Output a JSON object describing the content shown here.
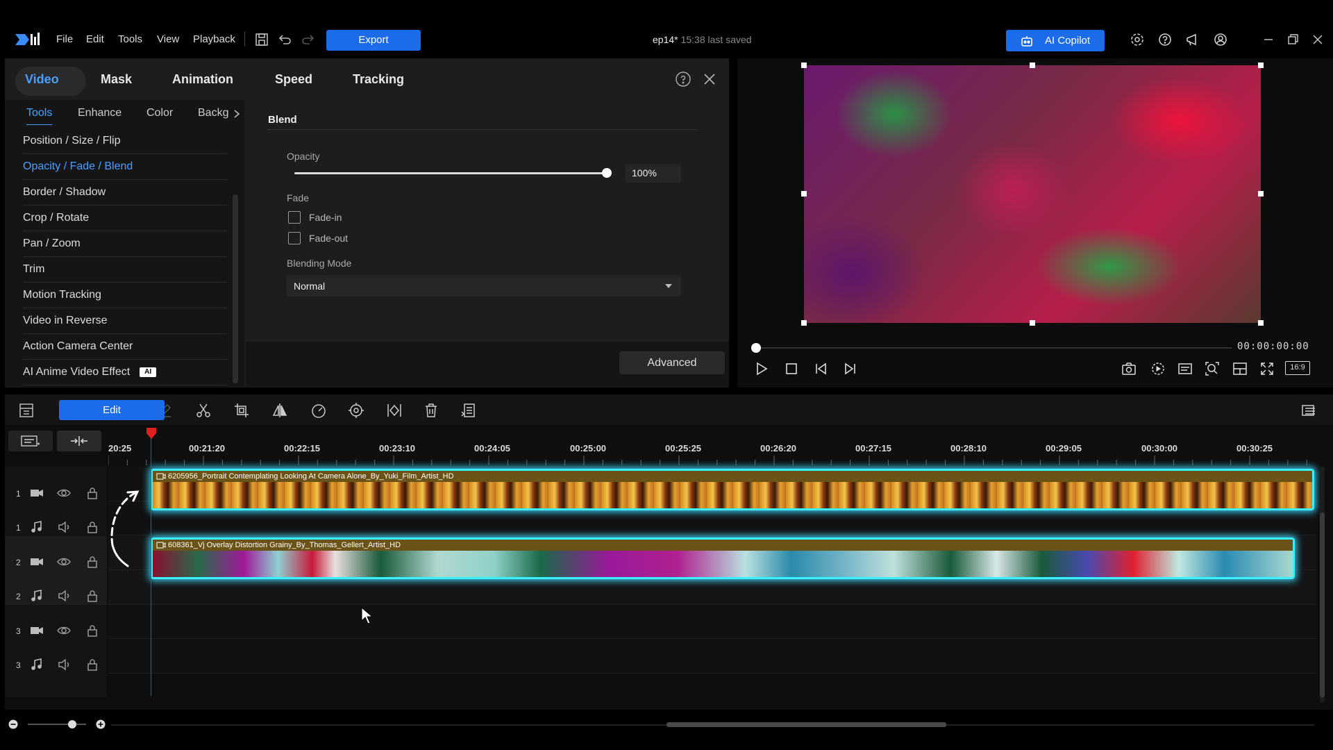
{
  "menu": {
    "file": "File",
    "edit": "Edit",
    "tools": "Tools",
    "view": "View",
    "playback": "Playback"
  },
  "toolbar": {
    "export_label": "Export"
  },
  "project": {
    "name": "ep14*",
    "saved": "15:38 last saved"
  },
  "copilot": {
    "label": "AI Copilot"
  },
  "panel": {
    "tabs": [
      "Video",
      "Mask",
      "Animation",
      "Speed",
      "Tracking"
    ],
    "subtabs": [
      "Tools",
      "Enhance",
      "Color",
      "Backg"
    ],
    "tools": [
      "Position / Size / Flip",
      "Opacity / Fade / Blend",
      "Border / Shadow",
      "Crop / Rotate",
      "Pan / Zoom",
      "Trim",
      "Motion Tracking",
      "Video in Reverse",
      "Action Camera Center",
      "AI Anime Video Effect"
    ],
    "tools_badge": "AI",
    "section": "Blend",
    "opacity_label": "Opacity",
    "opacity_value": "100%",
    "opacity_level": 1.0,
    "fade_label": "Fade",
    "fade_in": "Fade-in",
    "fade_out": "Fade-out",
    "blending_label": "Blending Mode",
    "blending_value": "Normal",
    "advanced_label": "Advanced"
  },
  "preview": {
    "timecode": "00:00:00:00",
    "aspect": "16:9"
  },
  "timeline": {
    "edit_label": "Edit",
    "ruler": [
      "20:25",
      "00:21:20",
      "00:22:15",
      "00:23:10",
      "00:24:05",
      "00:25:00",
      "00:25:25",
      "00:26:20",
      "00:27:15",
      "00:28:10",
      "00:29:05",
      "00:30:00",
      "00:30:25"
    ],
    "tracks": [
      {
        "num": "1",
        "type": "video"
      },
      {
        "num": "1",
        "type": "audio"
      },
      {
        "num": "2",
        "type": "video"
      },
      {
        "num": "2",
        "type": "audio"
      },
      {
        "num": "3",
        "type": "video"
      },
      {
        "num": "3",
        "type": "audio"
      }
    ],
    "clip1": "6205956_Portrait Contemplating Looking At Camera Alone_By_Yuki_Film_Artist_HD",
    "clip2": "608361_Vj Overlay Distortion Grainy_By_Thomas_Gellert_Artist_HD"
  },
  "colors": {
    "accent": "#1c6be8",
    "selection": "#3df0ff",
    "playhead": "#e02020"
  }
}
